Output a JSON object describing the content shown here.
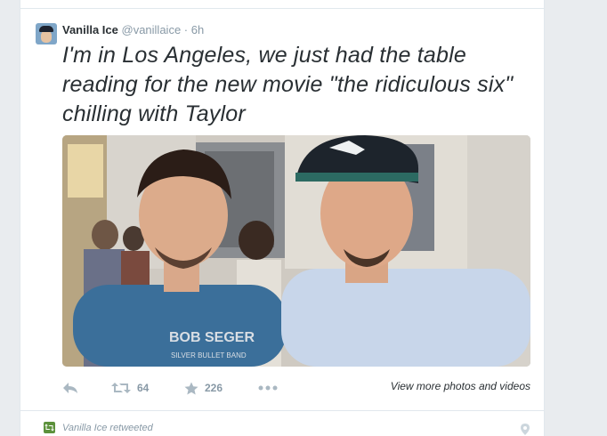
{
  "tweet": {
    "author_name": "Vanilla Ice",
    "author_handle": "@vanillaice",
    "separator": "·",
    "time": "6h",
    "text": "I'm in Los Angeles, we just had the table reading for the new movie \"the ridiculous six\" chilling with Taylor",
    "photo_shirt_text": "BOB SEGER",
    "photo_shirt_subtext": "SILVER BULLET BAND"
  },
  "actions": {
    "reply_icon": "reply-icon",
    "retweet_icon": "retweet-icon",
    "retweet_count": "64",
    "favorite_icon": "star-icon",
    "favorite_count": "226",
    "more_icon": "ellipsis-icon",
    "view_more": "View more photos and videos"
  },
  "next": {
    "retweet_context": "Vanilla Ice retweeted",
    "icon": "location-pin-icon"
  },
  "colors": {
    "name": "#292f33",
    "muted": "#8899a6",
    "retweet_green": "#5c913b",
    "divider": "#e1e8ed"
  }
}
